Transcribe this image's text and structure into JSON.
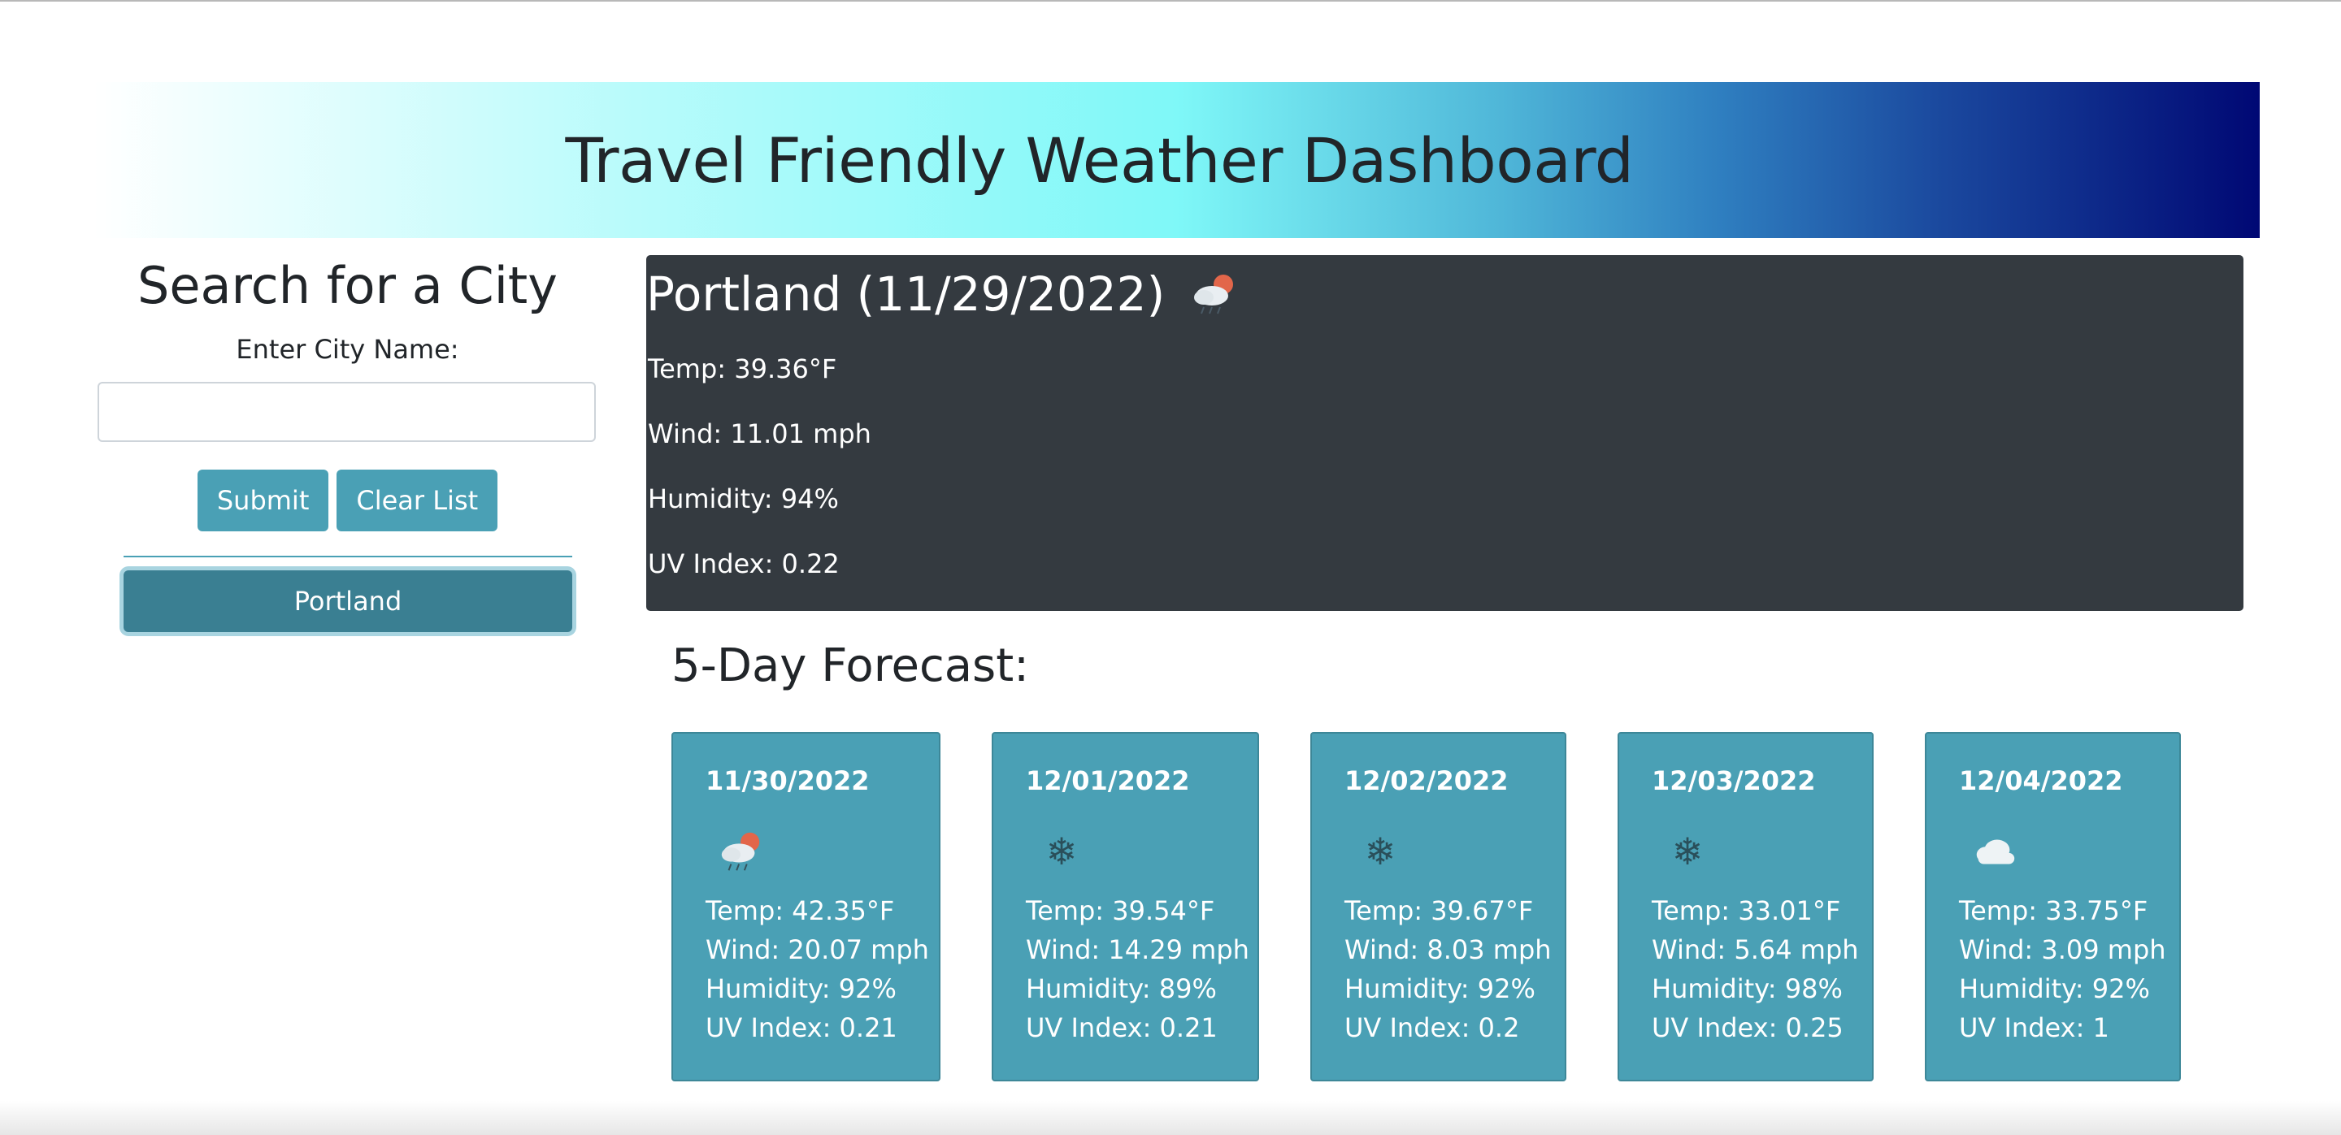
{
  "header": {
    "title": "Travel Friendly Weather Dashboard"
  },
  "search": {
    "title": "Search for a City",
    "label": "Enter City Name:",
    "input_value": "",
    "submit_label": "Submit",
    "clear_label": "Clear List",
    "history": [
      "Portland"
    ]
  },
  "current": {
    "city_date": "Portland (11/29/2022)",
    "icon": "rain-sun-cloud-icon",
    "temp": "Temp: 39.36°F",
    "wind": "Wind: 11.01 mph",
    "humidity": "Humidity: 94%",
    "uv": "UV Index: 0.22"
  },
  "forecast": {
    "title": "5-Day Forecast:",
    "days": [
      {
        "date": "11/30/2022",
        "icon": "rain-sun-cloud-icon",
        "temp": "Temp: 42.35°F",
        "wind": "Wind: 20.07 mph",
        "humidity": "Humidity: 92%",
        "uv": "UV Index: 0.21"
      },
      {
        "date": "12/01/2022",
        "icon": "snowflake-icon",
        "temp": "Temp: 39.54°F",
        "wind": "Wind: 14.29 mph",
        "humidity": "Humidity: 89%",
        "uv": "UV Index: 0.21"
      },
      {
        "date": "12/02/2022",
        "icon": "snowflake-icon",
        "temp": "Temp: 39.67°F",
        "wind": "Wind: 8.03 mph",
        "humidity": "Humidity: 92%",
        "uv": "UV Index: 0.2"
      },
      {
        "date": "12/03/2022",
        "icon": "snowflake-icon",
        "temp": "Temp: 33.01°F",
        "wind": "Wind: 5.64 mph",
        "humidity": "Humidity: 98%",
        "uv": "UV Index: 0.25"
      },
      {
        "date": "12/04/2022",
        "icon": "cloud-icon",
        "temp": "Temp: 33.75°F",
        "wind": "Wind: 3.09 mph",
        "humidity": "Humidity: 92%",
        "uv": "UV Index: 1"
      }
    ]
  },
  "colors": {
    "accent": "#4aa0b5",
    "history_button": "#3a7f92",
    "current_panel": "#343a40"
  }
}
